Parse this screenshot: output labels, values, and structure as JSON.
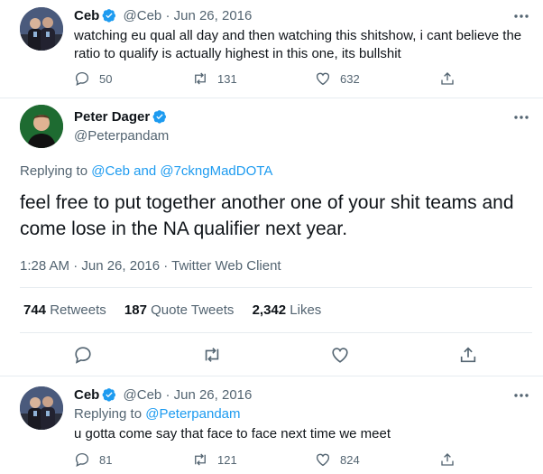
{
  "tweet1": {
    "display_name": "Ceb",
    "handle": "@Ceb",
    "dot": "·",
    "date": "Jun 26, 2016",
    "text": "watching eu qual all day and then watching this shitshow, i cant believe the ratio to qualify is actually highest in this one, its bullshit",
    "replies": "50",
    "retweets": "131",
    "likes": "632"
  },
  "tweet2": {
    "display_name": "Peter Dager",
    "handle": "@Peterpandam",
    "replying_prefix": "Replying to",
    "reply_to_1": "@Ceb",
    "reply_and": "and",
    "reply_to_2": "@7ckngMadDOTA",
    "text": "feel free to put together another one of your shit teams and come lose in the NA qualifier next year.",
    "meta": "1:28 AM · Jun 26, 2016 · Twitter Web Client",
    "retweets_count": "744",
    "retweets_label": "Retweets",
    "quote_count": "187",
    "quote_label": "Quote Tweets",
    "likes_count": "2,342",
    "likes_label": "Likes"
  },
  "tweet3": {
    "display_name": "Ceb",
    "handle": "@Ceb",
    "dot": "·",
    "date": "Jun 26, 2016",
    "replying_prefix": "Replying to",
    "reply_to": "@Peterpandam",
    "text": "u gotta come say that face to face next time we meet",
    "replies": "81",
    "retweets": "121",
    "likes": "824"
  },
  "icons": [
    "verified-badge-icon",
    "more-options-icon",
    "reply-icon",
    "retweet-icon",
    "like-icon",
    "share-icon"
  ],
  "colors": {
    "accent": "#1d9bf0",
    "muted": "#536471",
    "text": "#0f1419",
    "border": "#e6ecf0"
  }
}
